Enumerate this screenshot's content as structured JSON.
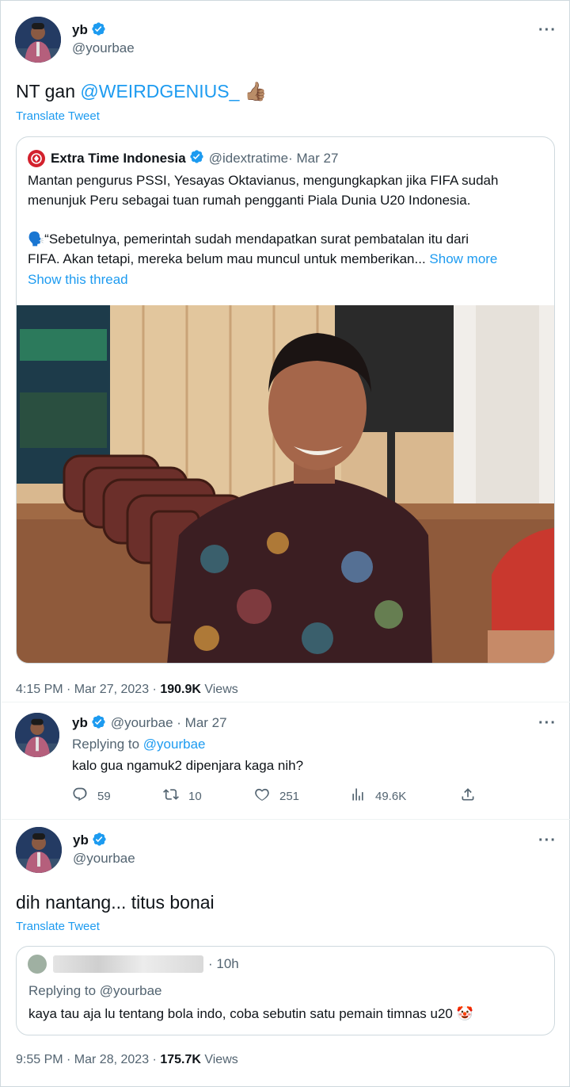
{
  "main_tweet": {
    "author_name": "yb",
    "author_handle": "@yourbae",
    "text_prefix": "NT gan ",
    "mention": "@WEIRDGENIUS_",
    "emoji": "👍🏽",
    "translate": "Translate Tweet",
    "timestamp": "4:15 PM · Mar 27, 2023 · ",
    "views_count": "190.9K",
    "views_label": " Views"
  },
  "quoted_tweet": {
    "author_name": "Extra Time Indonesia",
    "author_handle": "@idextratime",
    "date": " · Mar 27",
    "line1": "Mantan pengurus PSSI, Yesayas Oktavianus, mengungkapkan jika FIFA sudah",
    "line2": "menunjuk Peru sebagai tuan rumah pengganti Piala Dunia U20 Indonesia.",
    "line3": "🗣️“Sebetulnya, pemerintah sudah mendapatkan surat pembatalan itu dari",
    "line4": "FIFA. Akan tetapi, mereka belum mau muncul untuk memberikan...",
    "show_more": "Show more",
    "show_thread": "Show this thread"
  },
  "reply_tweet": {
    "author_name": "yb",
    "author_handle": "@yourbae",
    "date": " · Mar 27",
    "replying_prefix": "Replying to ",
    "replying_handle": "@yourbae",
    "text": "kalo gua ngamuk2 dipenjara kaga nih?",
    "replies": "59",
    "retweets": "10",
    "likes": "251",
    "views": "49.6K"
  },
  "second_tweet": {
    "author_name": "yb",
    "author_handle": "@yourbae",
    "text": "dih nantang... titus bonai",
    "translate": "Translate Tweet",
    "timestamp": "9:55 PM · Mar 28, 2023 · ",
    "views_count": "175.7K",
    "views_label": " Views"
  },
  "quoted_reply": {
    "time": "· 10h",
    "replying_prefix": "Replying to ",
    "replying_handle": "@yourbae",
    "text": "kaya tau aja lu tentang bola indo, coba sebutin satu pemain timnas u20 🤡"
  },
  "colors": {
    "accent": "#1d9bf0",
    "muted": "#536471",
    "border": "#cfd9de",
    "text": "#0f1419"
  },
  "icons": [
    "verified-badge-icon",
    "more-icon",
    "reply-icon",
    "retweet-icon",
    "like-icon",
    "views-icon",
    "share-icon",
    "extra-time-logo-icon"
  ]
}
